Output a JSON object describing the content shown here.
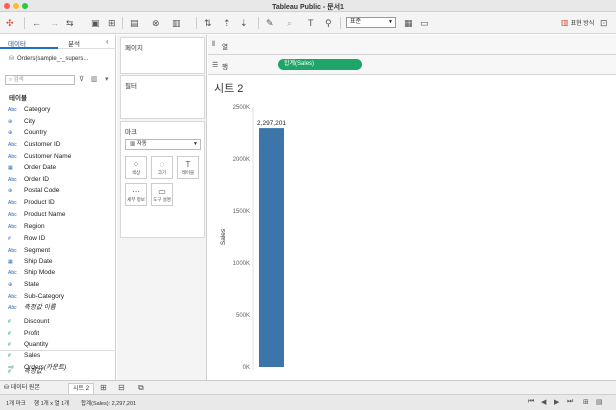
{
  "window": {
    "title": "Tableau Public - 문서1"
  },
  "toolbar": {
    "fit_value": "표준",
    "show_me_label": "표현 방식"
  },
  "left_panel": {
    "tabs": [
      "데이터",
      "분석"
    ],
    "data_source": "Orders(sample_-_supers...",
    "search_placeholder": "검색",
    "table_header": "테이블",
    "fields": [
      {
        "type": "Abc",
        "name": "Category",
        "kind": "dim"
      },
      {
        "type": "⊕",
        "name": "City",
        "kind": "dim"
      },
      {
        "type": "⊕",
        "name": "Country",
        "kind": "dim"
      },
      {
        "type": "Abc",
        "name": "Customer ID",
        "kind": "dim"
      },
      {
        "type": "Abc",
        "name": "Customer Name",
        "kind": "dim"
      },
      {
        "type": "▦",
        "name": "Order Date",
        "kind": "dim"
      },
      {
        "type": "Abc",
        "name": "Order ID",
        "kind": "dim"
      },
      {
        "type": "⊕",
        "name": "Postal Code",
        "kind": "dim"
      },
      {
        "type": "Abc",
        "name": "Product ID",
        "kind": "dim"
      },
      {
        "type": "Abc",
        "name": "Product Name",
        "kind": "dim"
      },
      {
        "type": "Abc",
        "name": "Region",
        "kind": "dim"
      },
      {
        "type": "#",
        "name": "Row ID",
        "kind": "dim"
      },
      {
        "type": "Abc",
        "name": "Segment",
        "kind": "dim"
      },
      {
        "type": "▦",
        "name": "Ship Date",
        "kind": "dim"
      },
      {
        "type": "Abc",
        "name": "Ship Mode",
        "kind": "dim"
      },
      {
        "type": "⊕",
        "name": "State",
        "kind": "dim"
      },
      {
        "type": "Abc",
        "name": "Sub-Category",
        "kind": "dim"
      },
      {
        "type": "Abc",
        "name": "측정값 이름",
        "kind": "dim",
        "italic": true
      },
      {
        "type": "#",
        "name": "Discount",
        "kind": "mea"
      },
      {
        "type": "#",
        "name": "Profit",
        "kind": "mea"
      },
      {
        "type": "#",
        "name": "Quantity",
        "kind": "mea"
      },
      {
        "type": "#",
        "name": "Sales",
        "kind": "mea"
      },
      {
        "type": "=#",
        "name": "Orders(카운트)",
        "kind": "mea",
        "italic": true
      },
      {
        "type": "#",
        "name": "측정값",
        "kind": "mea",
        "italic": true
      }
    ]
  },
  "cards": {
    "pages": "페이지",
    "filters": "필터",
    "marks": "마크",
    "mark_type": "자동",
    "mark_buttons": [
      {
        "label": "색상",
        "glyph": "⁘"
      },
      {
        "label": "크기",
        "glyph": "◌"
      },
      {
        "label": "레이블",
        "glyph": "T"
      },
      {
        "label": "세부 정보",
        "glyph": "⋯"
      },
      {
        "label": "도구 설명",
        "glyph": "▭"
      }
    ]
  },
  "shelves": {
    "columns_label": "열",
    "rows_label": "행",
    "rows_pill": "합계(Sales)"
  },
  "sheet": {
    "title": "시트 2"
  },
  "chart_data": {
    "type": "bar",
    "categories": [
      ""
    ],
    "values": [
      2297201
    ],
    "ylabel": "Sales",
    "ylim": [
      0,
      2500000
    ],
    "yticks": [
      0,
      500000,
      1000000,
      1500000,
      2000000,
      2500000
    ],
    "ytick_labels": [
      "0K",
      "500K",
      "1000K",
      "1500K",
      "2000K",
      "2500K"
    ],
    "data_labels": [
      "2,297,201"
    ],
    "bar_color": "#3b75a9",
    "grid": false
  },
  "bottom_tabs": {
    "data_source": "데이터 원본",
    "sheet": "시트 2"
  },
  "status": {
    "marks": "1개 마크",
    "rows_cols": "행 1개 x 열 1개",
    "sum": "합계(Sales): 2,297,201"
  },
  "colors": {
    "accent": "#1f6ec7",
    "pill_green": "#1fa567"
  }
}
